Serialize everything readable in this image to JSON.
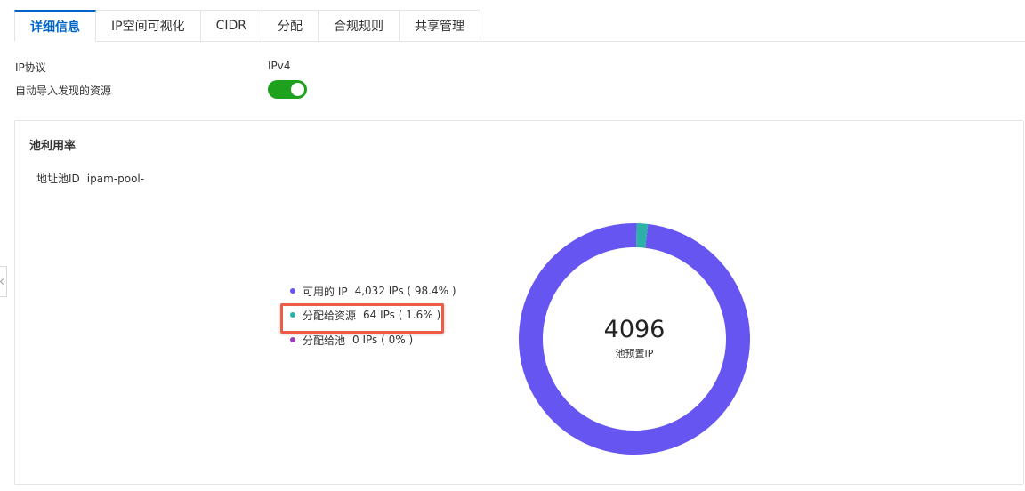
{
  "tabs": [
    {
      "label": "详细信息",
      "active": true
    },
    {
      "label": "IP空间可视化",
      "active": false
    },
    {
      "label": "CIDR",
      "active": false
    },
    {
      "label": "分配",
      "active": false
    },
    {
      "label": "合规规则",
      "active": false
    },
    {
      "label": "共享管理",
      "active": false
    }
  ],
  "details": {
    "ip_protocol_label": "IP协议",
    "ip_protocol_value": "IPv4",
    "auto_import_label": "自动导入发现的资源",
    "auto_import_enabled": true
  },
  "utilization": {
    "title": "池利用率",
    "pool_id_label": "地址池ID",
    "pool_id_value": "ipam-pool-",
    "total": "4096",
    "total_label": "池预置IP",
    "legend": [
      {
        "name": "可用的 IP",
        "value": "4,032 IPs ( 98.4% )",
        "color": "#6655f0"
      },
      {
        "name": "分配给资源",
        "value": "64 IPs ( 1.6% )",
        "color": "#2db0a8"
      },
      {
        "name": "分配给池",
        "value": "0 IPs ( 0% )",
        "color": "#9c3fb5"
      }
    ],
    "highlighted_item": "分配给资源"
  },
  "chart_data": {
    "type": "pie",
    "categories": [
      "可用的 IP",
      "分配给资源",
      "分配给池"
    ],
    "values": [
      4032,
      64,
      0
    ],
    "colors": [
      "#6655f0",
      "#2db0a8",
      "#9c3fb5"
    ],
    "title": "池利用率",
    "center_value": "4096",
    "center_label": "池预置IP"
  }
}
